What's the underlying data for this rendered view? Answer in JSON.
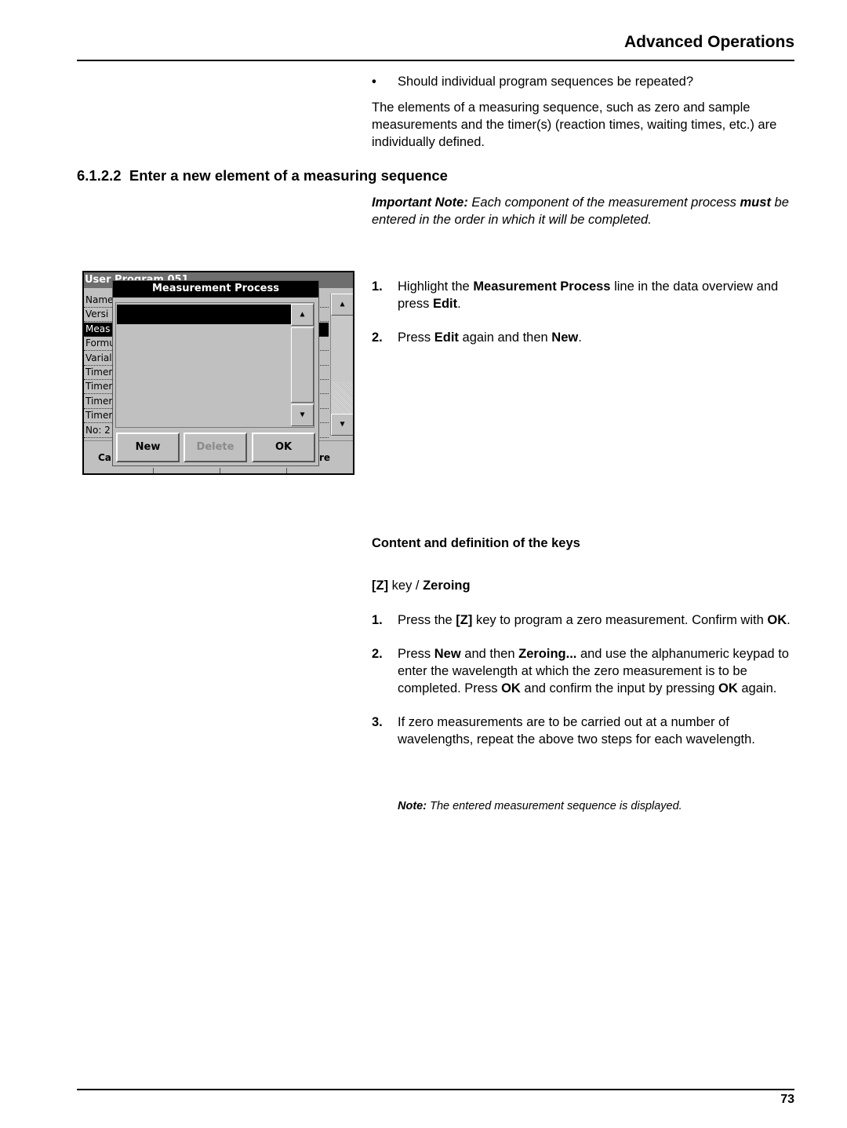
{
  "header": {
    "title": "Advanced Operations"
  },
  "intro": {
    "bullet": "Should individual program sequences be repeated?",
    "paragraph": "The elements of a measuring sequence, such as zero and sample measurements and the timer(s) (reaction times, waiting times, etc.) are individually defined."
  },
  "section": {
    "number": "6.1.2.2",
    "title": "Enter a new element of a measuring sequence"
  },
  "important": {
    "label": "Important Note:",
    "text1": " Each component of the measurement process ",
    "must": "must",
    "text2": " be entered in the order in which it will be completed."
  },
  "steps": [
    {
      "n": "1.",
      "a": "Highlight the ",
      "b1": "Measurement Process",
      "c": " line in the data overview and press ",
      "b2": "Edit",
      "d": "."
    },
    {
      "n": "2.",
      "a": "Press ",
      "b1": "Edit",
      "c": " again and then ",
      "b2": "New",
      "d": "."
    }
  ],
  "screen": {
    "title": "User Program   051",
    "rows": [
      "Name",
      "Versi",
      "Meas",
      "Formu",
      "Varial",
      "Timer",
      "Timer",
      "Timer",
      "Timer",
      "No: 2"
    ],
    "selected_row": 2,
    "bottom_left": "Ca",
    "bottom_right": "re",
    "dialog": {
      "title": "Measurement Process",
      "buttons": [
        {
          "label": "New",
          "enabled": true
        },
        {
          "label": "Delete",
          "enabled": false
        },
        {
          "label": "OK",
          "enabled": true
        }
      ]
    },
    "icons": {
      "up": "▲",
      "down": "▼"
    }
  },
  "keys": {
    "heading": "Content and definition of the keys",
    "subheading_key": "[Z]",
    "subheading_mid": " key / ",
    "subheading_name": "Zeroing",
    "steps": [
      {
        "n": "1.",
        "html_parts": [
          "Press the ",
          "[Z]",
          " key to program a zero measurement. Confirm with ",
          "OK",
          "."
        ]
      },
      {
        "n": "2.",
        "html_parts": [
          "Press ",
          "New",
          " and then ",
          "Zeroing...",
          " and use the alphanumeric keypad to enter the wavelength at which the zero measurement is to be completed. Press ",
          "OK",
          " and confirm the input by pressing ",
          "OK",
          " again."
        ]
      },
      {
        "n": "3.",
        "html_parts": [
          "If zero measurements are to be carried out at a number of wavelengths, repeat the above two steps for each wavelength."
        ]
      }
    ],
    "note_label": "Note:",
    "note_text": " The entered measurement sequence is displayed."
  },
  "footer": {
    "page": "73"
  }
}
